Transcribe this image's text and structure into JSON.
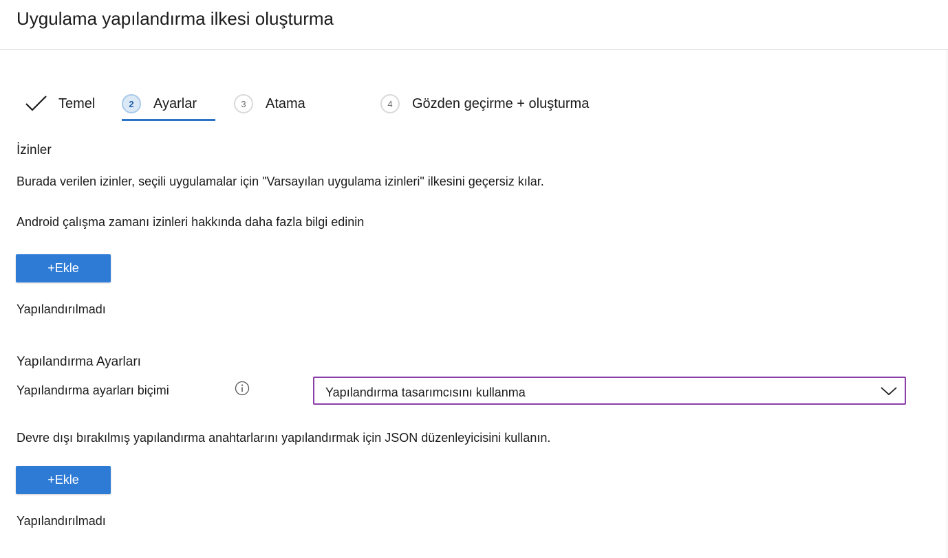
{
  "header": {
    "title": "Uygulama yapılandırma ilkesi oluşturma"
  },
  "wizard": {
    "steps": [
      {
        "number": "",
        "label": "Temel",
        "state": "completed"
      },
      {
        "number": "2",
        "label": "Ayarlar",
        "state": "active"
      },
      {
        "number": "3",
        "label": "Atama",
        "state": "pending"
      },
      {
        "number": "4",
        "label": "Gözden geçirme + oluşturma",
        "state": "pending"
      }
    ]
  },
  "permissions": {
    "title": "İzinler",
    "description": "Burada verilen izinler, seçili uygulamalar için \"Varsayılan uygulama izinleri\" ilkesini geçersiz kılar.",
    "link_text": "Android çalışma zamanı izinleri hakkında daha fazla bilgi edinin",
    "add_label": "+Ekle",
    "status": "Yapılandırılmadı"
  },
  "config_settings": {
    "title": "Yapılandırma Ayarları",
    "format_label": "Yapılandırma ayarları biçimi",
    "format_value": "Yapılandırma tasarımcısını kullanma",
    "json_text": "Devre dışı bırakılmış yapılandırma anahtarlarını yapılandırmak için JSON düzenleyicisini kullanın.",
    "add_label": "+Ekle",
    "status": "Yapılandırılmadı"
  },
  "colors": {
    "accent": "#2e7bd6",
    "select_border": "#8a3ea8",
    "step_underline": "#2b73c6"
  },
  "icons": {
    "step1": "checkmark-icon",
    "info": "info-icon",
    "dropdown": "chevron-down-icon"
  }
}
